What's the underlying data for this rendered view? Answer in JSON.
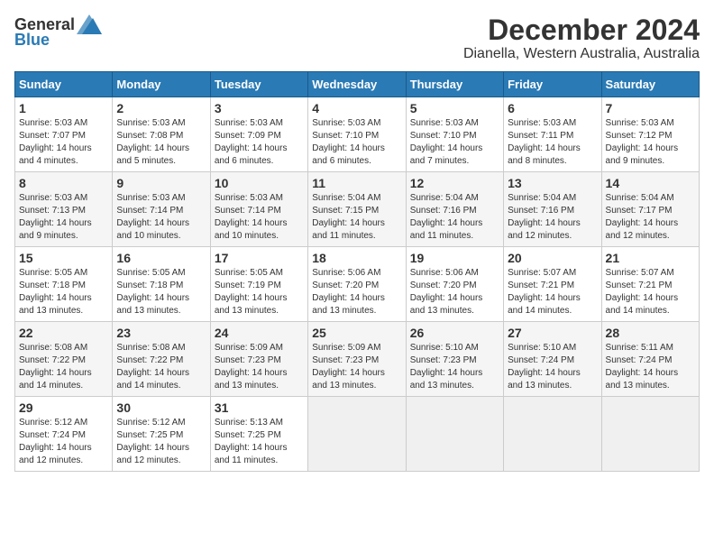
{
  "header": {
    "logo_general": "General",
    "logo_blue": "Blue",
    "title": "December 2024",
    "subtitle": "Dianella, Western Australia, Australia"
  },
  "calendar": {
    "days_of_week": [
      "Sunday",
      "Monday",
      "Tuesday",
      "Wednesday",
      "Thursday",
      "Friday",
      "Saturday"
    ],
    "weeks": [
      [
        {
          "day": "1",
          "info": "Sunrise: 5:03 AM\nSunset: 7:07 PM\nDaylight: 14 hours and 4 minutes."
        },
        {
          "day": "2",
          "info": "Sunrise: 5:03 AM\nSunset: 7:08 PM\nDaylight: 14 hours and 5 minutes."
        },
        {
          "day": "3",
          "info": "Sunrise: 5:03 AM\nSunset: 7:09 PM\nDaylight: 14 hours and 6 minutes."
        },
        {
          "day": "4",
          "info": "Sunrise: 5:03 AM\nSunset: 7:10 PM\nDaylight: 14 hours and 6 minutes."
        },
        {
          "day": "5",
          "info": "Sunrise: 5:03 AM\nSunset: 7:10 PM\nDaylight: 14 hours and 7 minutes."
        },
        {
          "day": "6",
          "info": "Sunrise: 5:03 AM\nSunset: 7:11 PM\nDaylight: 14 hours and 8 minutes."
        },
        {
          "day": "7",
          "info": "Sunrise: 5:03 AM\nSunset: 7:12 PM\nDaylight: 14 hours and 9 minutes."
        }
      ],
      [
        {
          "day": "8",
          "info": "Sunrise: 5:03 AM\nSunset: 7:13 PM\nDaylight: 14 hours and 9 minutes."
        },
        {
          "day": "9",
          "info": "Sunrise: 5:03 AM\nSunset: 7:14 PM\nDaylight: 14 hours and 10 minutes."
        },
        {
          "day": "10",
          "info": "Sunrise: 5:03 AM\nSunset: 7:14 PM\nDaylight: 14 hours and 10 minutes."
        },
        {
          "day": "11",
          "info": "Sunrise: 5:04 AM\nSunset: 7:15 PM\nDaylight: 14 hours and 11 minutes."
        },
        {
          "day": "12",
          "info": "Sunrise: 5:04 AM\nSunset: 7:16 PM\nDaylight: 14 hours and 11 minutes."
        },
        {
          "day": "13",
          "info": "Sunrise: 5:04 AM\nSunset: 7:16 PM\nDaylight: 14 hours and 12 minutes."
        },
        {
          "day": "14",
          "info": "Sunrise: 5:04 AM\nSunset: 7:17 PM\nDaylight: 14 hours and 12 minutes."
        }
      ],
      [
        {
          "day": "15",
          "info": "Sunrise: 5:05 AM\nSunset: 7:18 PM\nDaylight: 14 hours and 13 minutes."
        },
        {
          "day": "16",
          "info": "Sunrise: 5:05 AM\nSunset: 7:18 PM\nDaylight: 14 hours and 13 minutes."
        },
        {
          "day": "17",
          "info": "Sunrise: 5:05 AM\nSunset: 7:19 PM\nDaylight: 14 hours and 13 minutes."
        },
        {
          "day": "18",
          "info": "Sunrise: 5:06 AM\nSunset: 7:20 PM\nDaylight: 14 hours and 13 minutes."
        },
        {
          "day": "19",
          "info": "Sunrise: 5:06 AM\nSunset: 7:20 PM\nDaylight: 14 hours and 13 minutes."
        },
        {
          "day": "20",
          "info": "Sunrise: 5:07 AM\nSunset: 7:21 PM\nDaylight: 14 hours and 14 minutes."
        },
        {
          "day": "21",
          "info": "Sunrise: 5:07 AM\nSunset: 7:21 PM\nDaylight: 14 hours and 14 minutes."
        }
      ],
      [
        {
          "day": "22",
          "info": "Sunrise: 5:08 AM\nSunset: 7:22 PM\nDaylight: 14 hours and 14 minutes."
        },
        {
          "day": "23",
          "info": "Sunrise: 5:08 AM\nSunset: 7:22 PM\nDaylight: 14 hours and 14 minutes."
        },
        {
          "day": "24",
          "info": "Sunrise: 5:09 AM\nSunset: 7:23 PM\nDaylight: 14 hours and 13 minutes."
        },
        {
          "day": "25",
          "info": "Sunrise: 5:09 AM\nSunset: 7:23 PM\nDaylight: 14 hours and 13 minutes."
        },
        {
          "day": "26",
          "info": "Sunrise: 5:10 AM\nSunset: 7:23 PM\nDaylight: 14 hours and 13 minutes."
        },
        {
          "day": "27",
          "info": "Sunrise: 5:10 AM\nSunset: 7:24 PM\nDaylight: 14 hours and 13 minutes."
        },
        {
          "day": "28",
          "info": "Sunrise: 5:11 AM\nSunset: 7:24 PM\nDaylight: 14 hours and 13 minutes."
        }
      ],
      [
        {
          "day": "29",
          "info": "Sunrise: 5:12 AM\nSunset: 7:24 PM\nDaylight: 14 hours and 12 minutes."
        },
        {
          "day": "30",
          "info": "Sunrise: 5:12 AM\nSunset: 7:25 PM\nDaylight: 14 hours and 12 minutes."
        },
        {
          "day": "31",
          "info": "Sunrise: 5:13 AM\nSunset: 7:25 PM\nDaylight: 14 hours and 11 minutes."
        },
        {
          "day": "",
          "info": ""
        },
        {
          "day": "",
          "info": ""
        },
        {
          "day": "",
          "info": ""
        },
        {
          "day": "",
          "info": ""
        }
      ]
    ]
  }
}
